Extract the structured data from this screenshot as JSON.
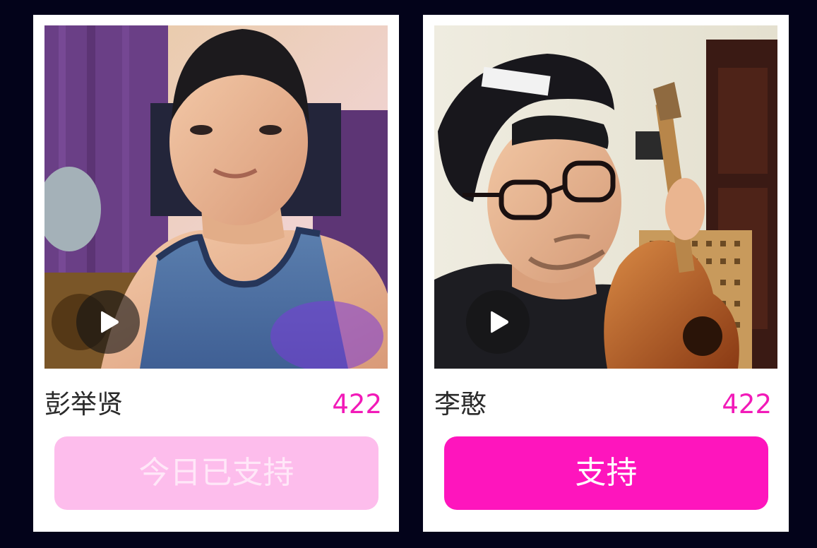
{
  "cards": [
    {
      "name": "彭举贤",
      "votes": "422",
      "button_label": "今日已支持",
      "button_state": "supported"
    },
    {
      "name": "李憨",
      "votes": "422",
      "button_label": "支持",
      "button_state": "active"
    }
  ],
  "colors": {
    "page_background": "#03031a",
    "vote_count": "#f21ab8",
    "button_active": "#fe15bd",
    "button_supported": "#fdbdec"
  }
}
